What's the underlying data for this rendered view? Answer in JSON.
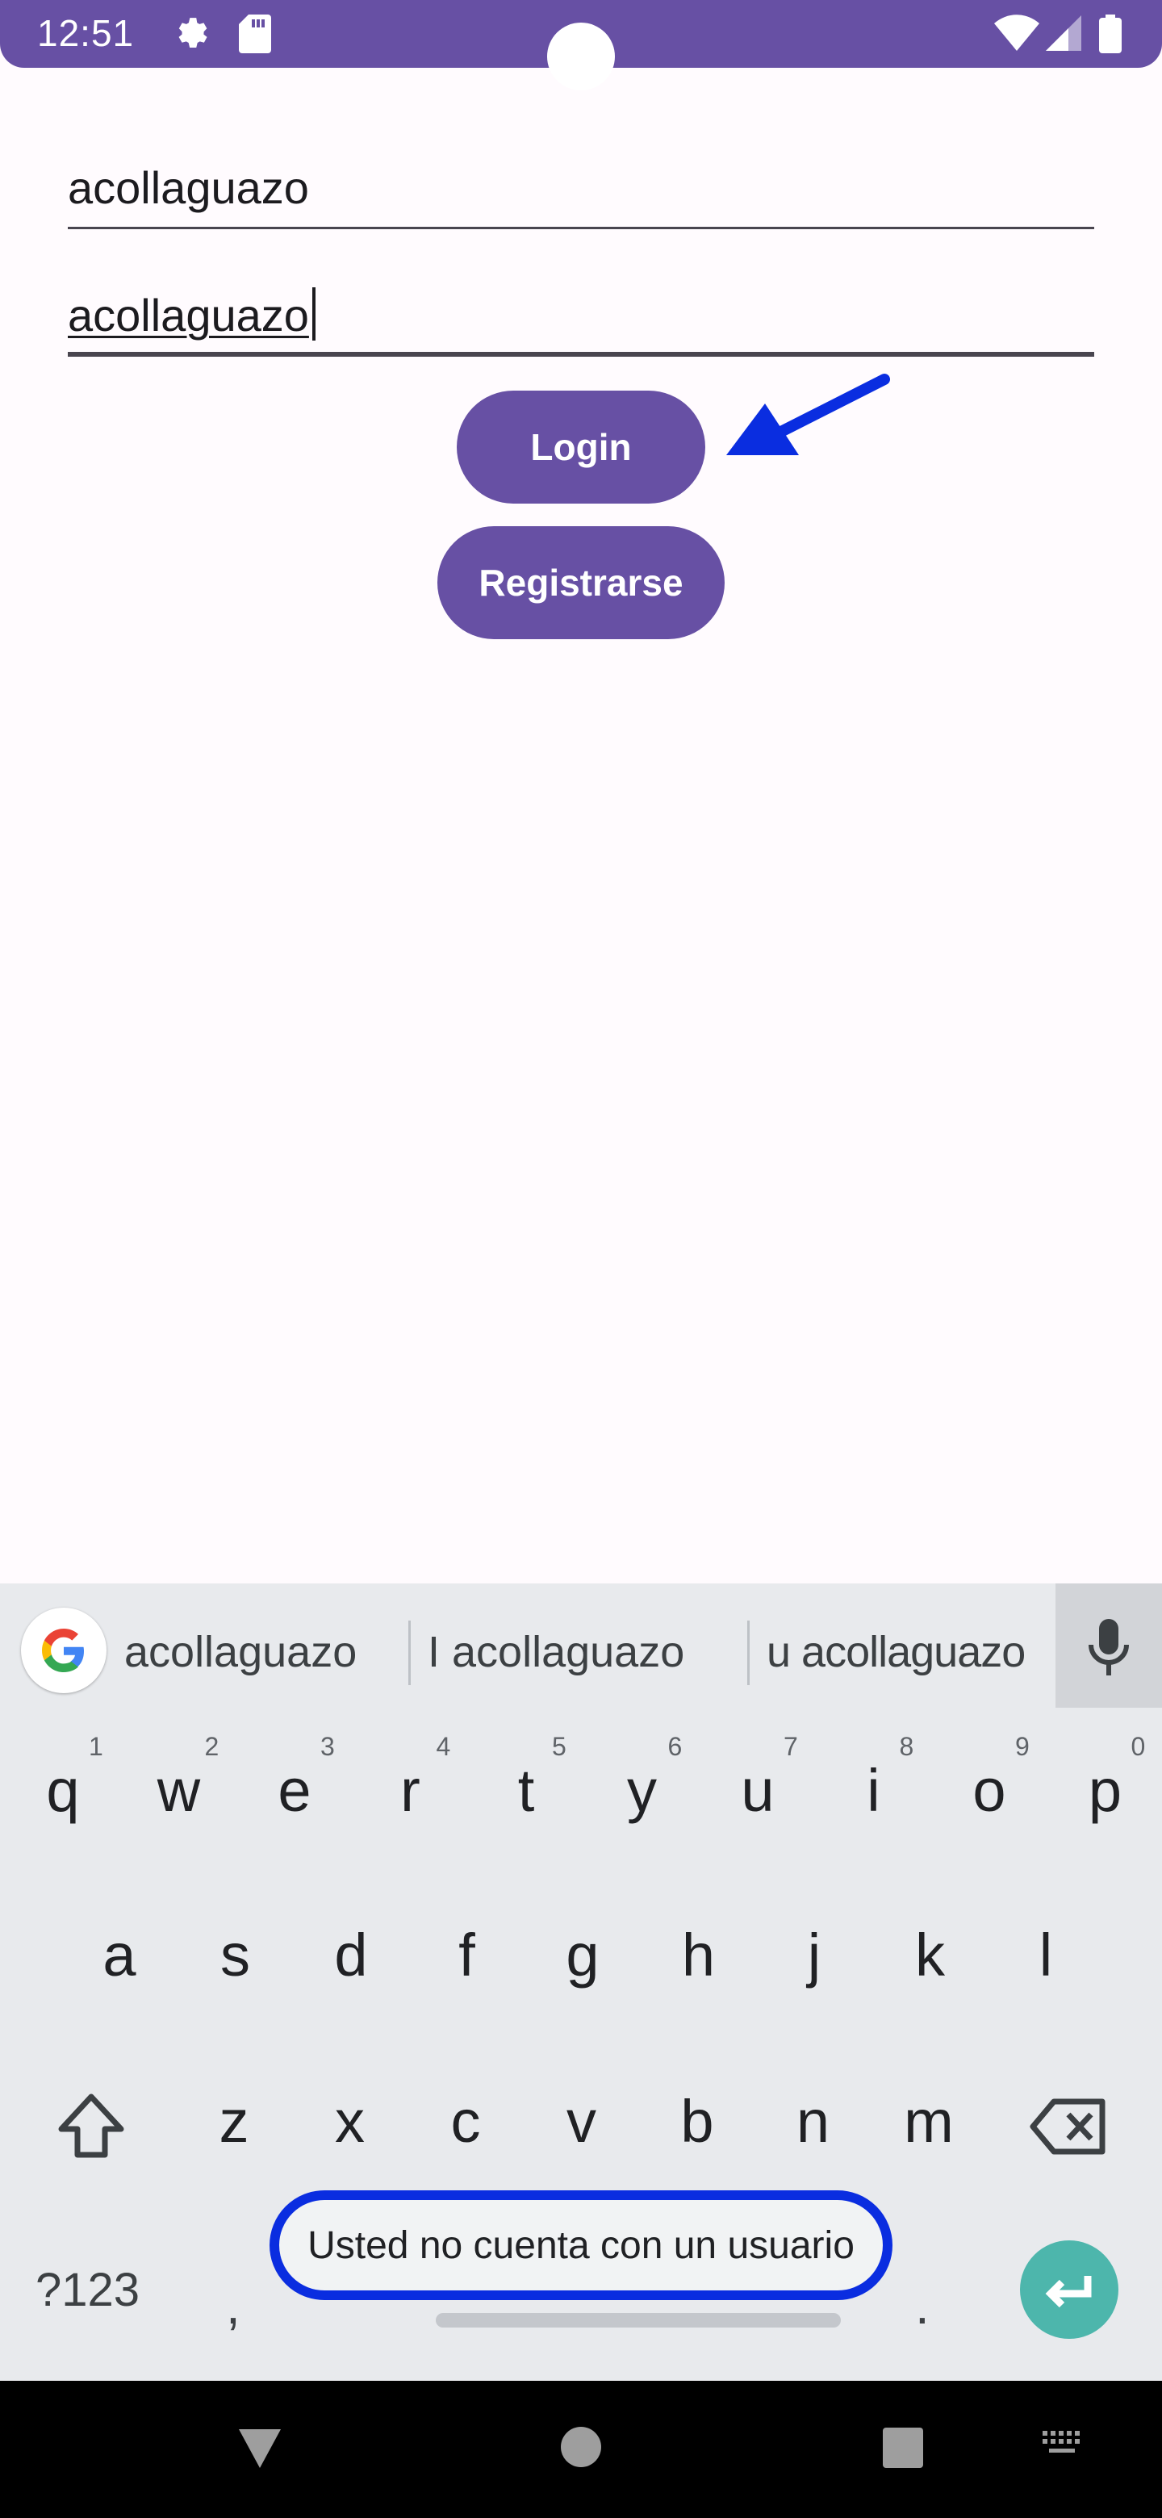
{
  "status_bar": {
    "time": "12:51",
    "icons": [
      "settings-icon",
      "sd-card-icon",
      "wifi-icon",
      "signal-icon",
      "battery-icon"
    ],
    "color": "#6750a4"
  },
  "form": {
    "username_value": "acollaguazo",
    "password_value": "acollaguazo",
    "login_label": "Login",
    "register_label": "Registrarse"
  },
  "keyboard": {
    "suggestions": [
      "acollaguazo",
      "I acollaguazo",
      "u acollaguazo"
    ],
    "row1": [
      {
        "k": "q",
        "h": "1"
      },
      {
        "k": "w",
        "h": "2"
      },
      {
        "k": "e",
        "h": "3"
      },
      {
        "k": "r",
        "h": "4"
      },
      {
        "k": "t",
        "h": "5"
      },
      {
        "k": "y",
        "h": "6"
      },
      {
        "k": "u",
        "h": "7"
      },
      {
        "k": "i",
        "h": "8"
      },
      {
        "k": "o",
        "h": "9"
      },
      {
        "k": "p",
        "h": "0"
      }
    ],
    "row2": [
      "a",
      "s",
      "d",
      "f",
      "g",
      "h",
      "j",
      "k",
      "l"
    ],
    "row3": [
      "z",
      "x",
      "c",
      "v",
      "b",
      "n",
      "m"
    ],
    "symbols_label": "?123",
    "comma_label": ",",
    "period_label": "."
  },
  "toast": {
    "message": "Usted no cuenta con un usuario"
  },
  "colors": {
    "primary": "#6750a4",
    "annotation": "#0a2de0",
    "enter_key": "#4db6ac"
  }
}
